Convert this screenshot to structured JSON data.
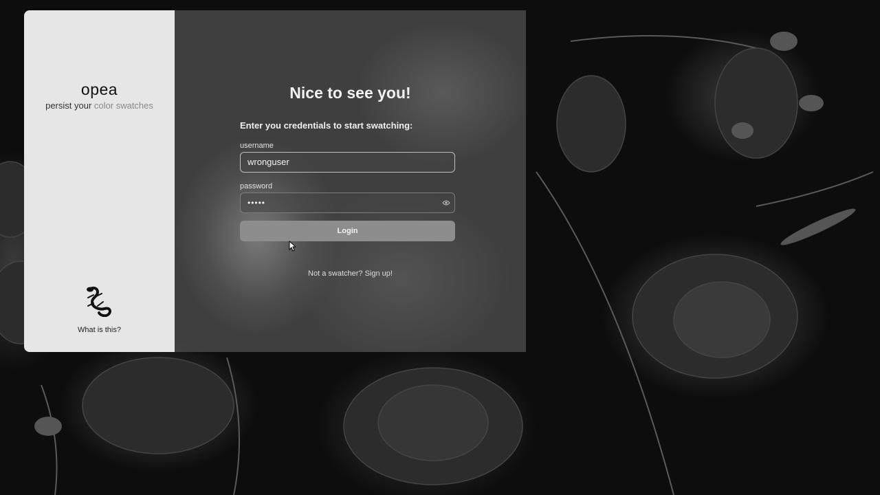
{
  "sidebar": {
    "brand": "opea",
    "tagline_start": "persist your ",
    "tagline_end": "color swatches",
    "help_link": "What is this?",
    "logo_icon": "salamander-icon"
  },
  "login": {
    "title": "Nice to see you!",
    "prompt": "Enter you credentials to start swatching:",
    "username_label": "username",
    "username_value": "wronguser",
    "password_label": "password",
    "password_value": "•••••",
    "reveal_icon": "eye-icon",
    "submit_label": "Login",
    "signup_link": "Not a swatcher? Sign up!"
  },
  "colors": {
    "sidebar_bg": "#e6e6e6",
    "card_bg": "rgba(80,80,80,0.75)",
    "button_bg": "#8d8d8d",
    "page_bg": "#0d0d0d"
  }
}
